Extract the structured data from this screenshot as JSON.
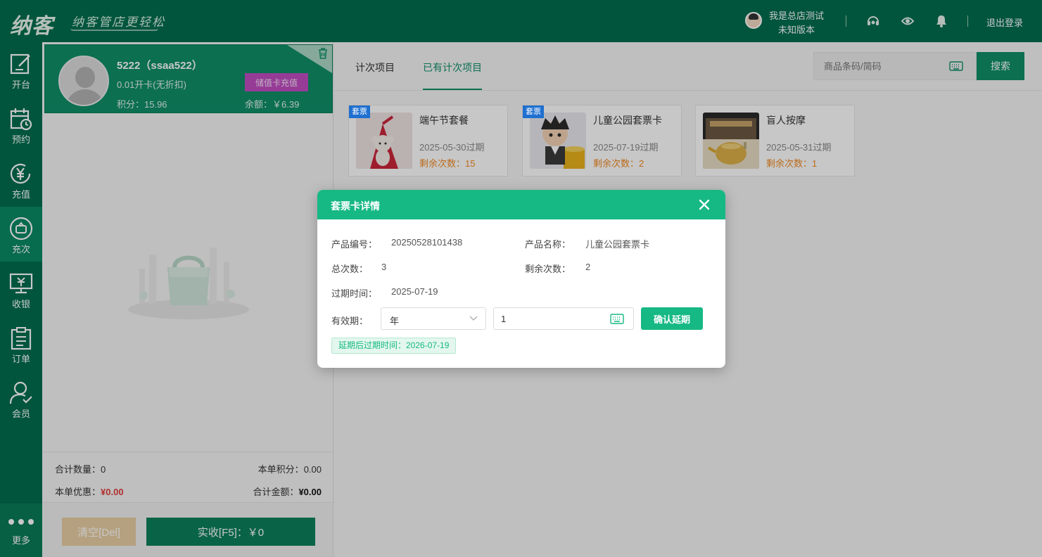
{
  "header": {
    "logo": "纳客",
    "slogan": "纳客管店更轻松",
    "user_name": "我是总店测试",
    "version": "未知版本",
    "logout": "退出登录",
    "icons": [
      "headset-icon",
      "eye-refresh-icon",
      "bell-icon"
    ]
  },
  "nav": {
    "items": [
      {
        "label": "开台",
        "icon": "edit-icon"
      },
      {
        "label": "预约",
        "icon": "calendar-clock-icon"
      },
      {
        "label": "充值",
        "icon": "yen-coin-icon"
      },
      {
        "label": "充次",
        "icon": "ticket-circle-icon"
      },
      {
        "label": "收银",
        "icon": "cash-register-icon"
      },
      {
        "label": "订单",
        "icon": "clipboard-icon"
      },
      {
        "label": "会员",
        "icon": "user-check-icon"
      }
    ],
    "more": "更多",
    "active_index": 3
  },
  "member": {
    "name": "5222（ssaa522）",
    "level": "0.01开卡(无折扣)",
    "points": "积分：15.96",
    "recharge_label": "储值卡充值",
    "balance": "余额：￥6.39"
  },
  "summary": {
    "total_qty_label": "合计数量：",
    "total_qty": "0",
    "points_label": "本单积分：",
    "points": "0.00",
    "discount_label": "本单优惠：",
    "discount": "¥0.00",
    "total_label": "合计金额：",
    "total": "¥0.00"
  },
  "buttons": {
    "clear": "清空[Del]",
    "pay": "实收[F5]：￥0",
    "search": "搜索"
  },
  "tabs": [
    {
      "label": "计次项目"
    },
    {
      "label": "已有计次项目"
    }
  ],
  "search": {
    "placeholder": "商品条码/简码"
  },
  "products": [
    {
      "tag": "套票",
      "name": "端午节套餐",
      "expire": "2025-05-30过期",
      "remain": "剩余次数：15"
    },
    {
      "tag": "套票",
      "name": "儿童公园套票卡",
      "expire": "2025-07-19过期",
      "remain": "剩余次数：2"
    },
    {
      "tag": "",
      "name": "盲人按摩",
      "expire": "2025-05-31过期",
      "remain": "剩余次数：1"
    }
  ],
  "modal": {
    "title": "套票卡详情",
    "code_label": "产品编号：",
    "code": "20250528101438",
    "name_label": "产品名称：",
    "name": "儿童公园套票卡",
    "total_label": "总次数：",
    "total": "3",
    "remain_label": "剩余次数：",
    "remain": "2",
    "expire_label": "过期时间：",
    "expire": "2025-07-19",
    "validity_label": "有效期：",
    "unit": "年",
    "amount": "1",
    "confirm": "确认延期",
    "new_expire": "延期后过期时间：2026-07-19"
  },
  "colors": {
    "primary_dark": "#016e4d",
    "primary": "#0f8f67",
    "modal_accent": "#16b884",
    "remain_orange": "#f08a24",
    "discount_red": "#e23b3b"
  }
}
